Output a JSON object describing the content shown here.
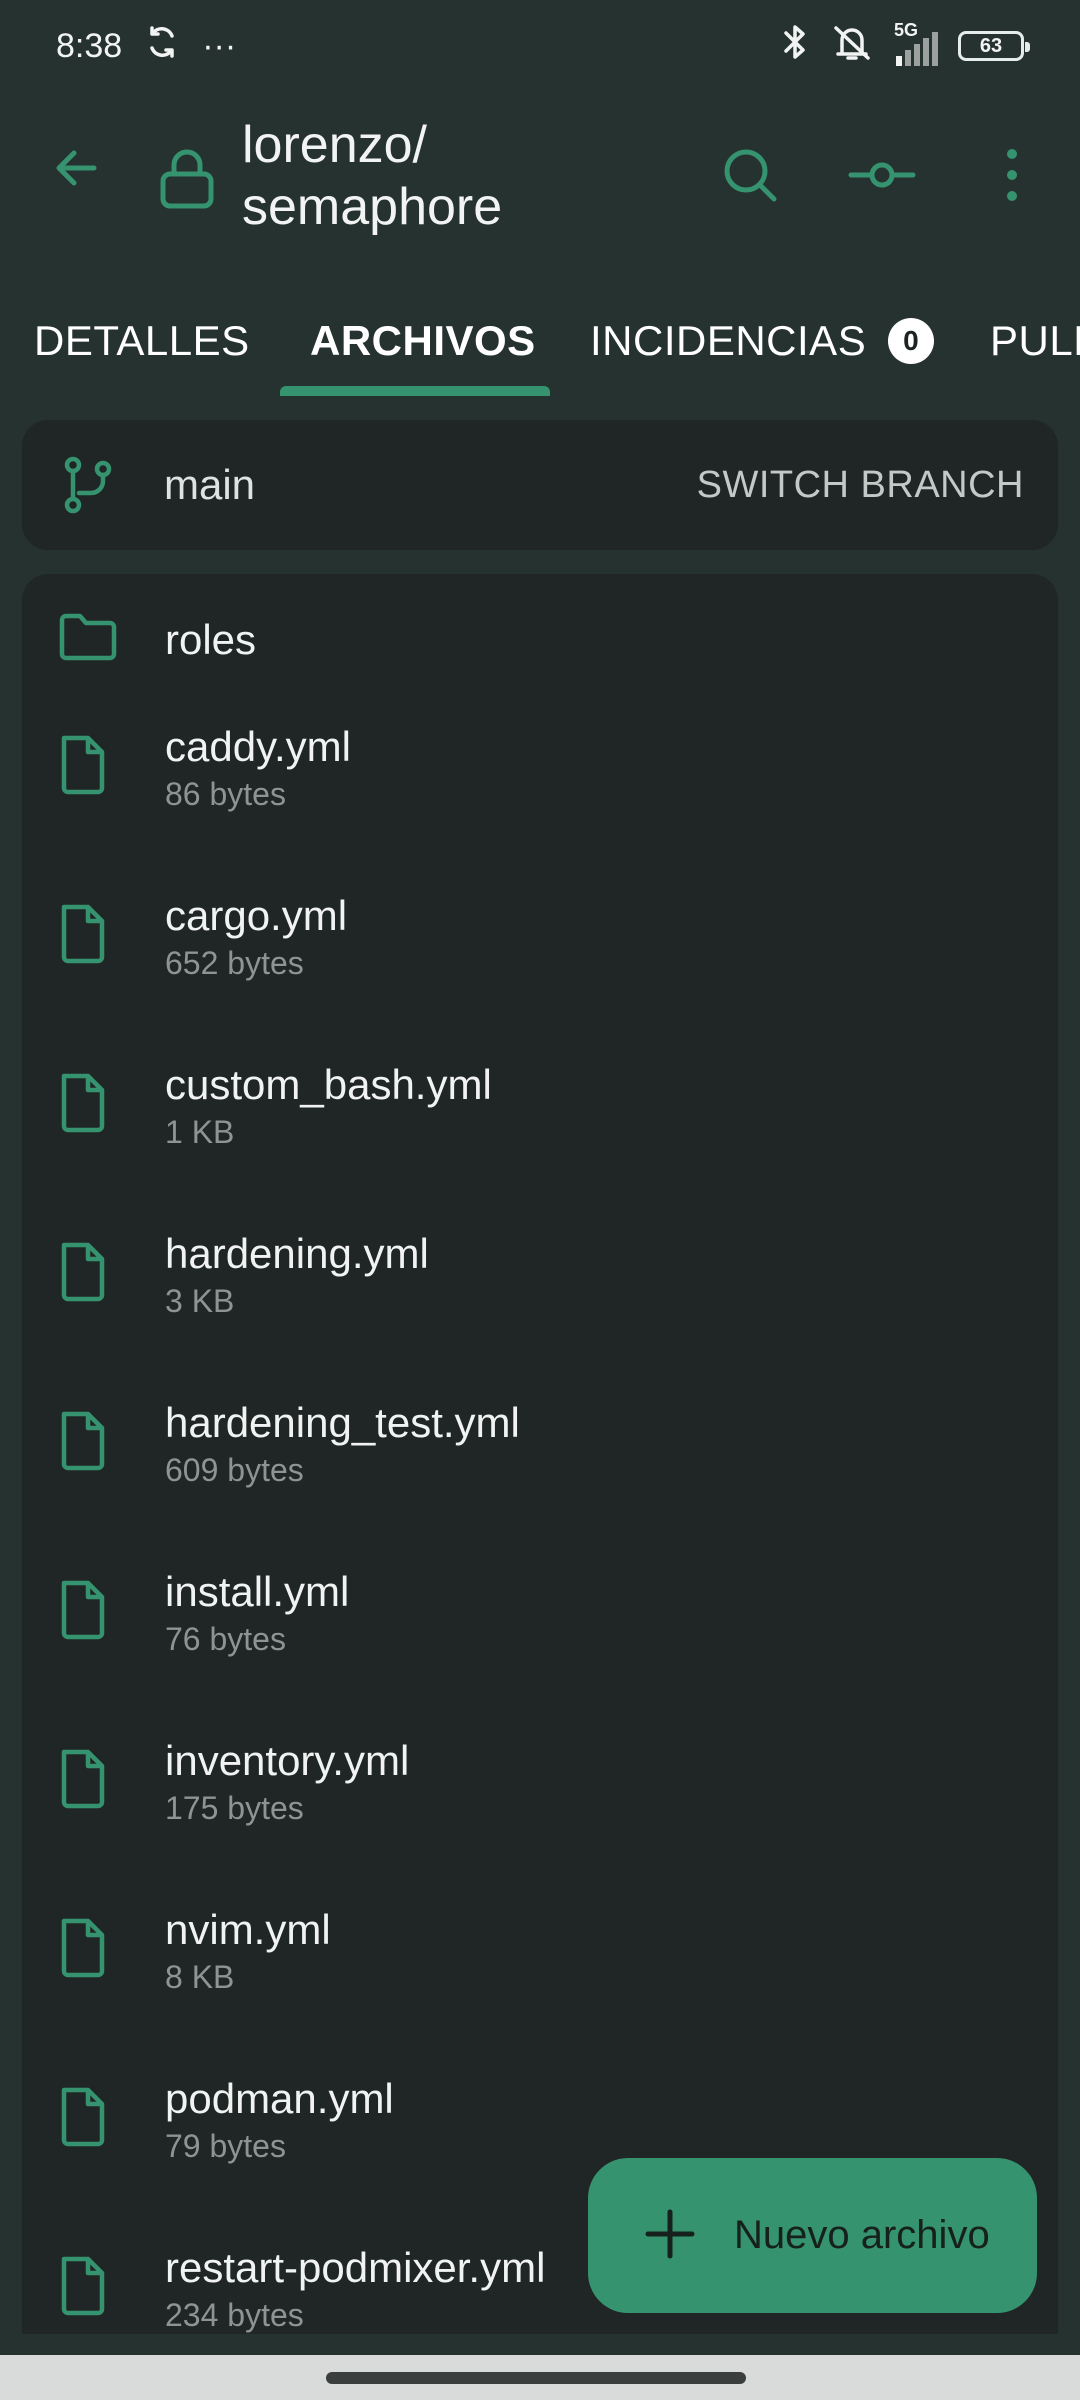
{
  "status_bar": {
    "time": "8:38",
    "dots": "···",
    "network": "5G",
    "battery": "63"
  },
  "app_bar": {
    "title_line1": "lorenzo/",
    "title_line2": "semaphore"
  },
  "tabs": [
    {
      "label": "DETALLES"
    },
    {
      "label": "ARCHIVOS"
    },
    {
      "label": "INCIDENCIAS",
      "badge": "0"
    },
    {
      "label": "PULL REQUESTS"
    }
  ],
  "branch": {
    "name": "main",
    "switch_label": "SWITCH BRANCH"
  },
  "files": [
    {
      "name": "roles",
      "type": "folder",
      "size": ""
    },
    {
      "name": "caddy.yml",
      "type": "file",
      "size": "86 bytes"
    },
    {
      "name": "cargo.yml",
      "type": "file",
      "size": "652 bytes"
    },
    {
      "name": "custom_bash.yml",
      "type": "file",
      "size": "1 KB"
    },
    {
      "name": "hardening.yml",
      "type": "file",
      "size": "3 KB"
    },
    {
      "name": "hardening_test.yml",
      "type": "file",
      "size": "609 bytes"
    },
    {
      "name": "install.yml",
      "type": "file",
      "size": "76 bytes"
    },
    {
      "name": "inventory.yml",
      "type": "file",
      "size": "175 bytes"
    },
    {
      "name": "nvim.yml",
      "type": "file",
      "size": "8 KB"
    },
    {
      "name": "podman.yml",
      "type": "file",
      "size": "79 bytes"
    },
    {
      "name": "restart-podmixer.yml",
      "type": "file",
      "size": "234 bytes"
    }
  ],
  "fab": {
    "label": "Nuevo archivo"
  },
  "colors": {
    "accent": "#35936f",
    "background": "#263230",
    "card": "#202626"
  }
}
